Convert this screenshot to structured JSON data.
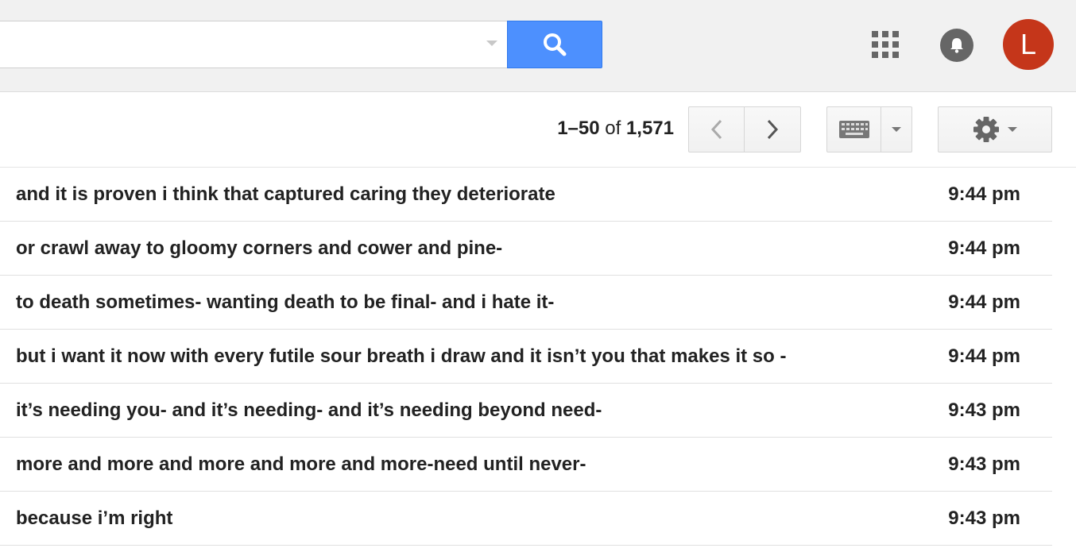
{
  "header": {
    "search": {
      "value": "",
      "placeholder": ""
    },
    "avatar_letter": "L",
    "accent_color": "#4d90fe",
    "avatar_color": "#c5361a",
    "icons": [
      "search-icon",
      "apps-grid-icon",
      "bell-icon"
    ]
  },
  "toolbar": {
    "range": "1–50",
    "of": "of",
    "total": "1,571",
    "icons": [
      "chevron-left-icon",
      "chevron-right-icon",
      "keyboard-icon",
      "caret-down-icon",
      "gear-icon"
    ]
  },
  "messages": [
    {
      "subject": "and it is proven i think that captured caring they deteriorate",
      "time": "9:44 pm"
    },
    {
      "subject": "or crawl away to gloomy corners and cower and pine-",
      "time": "9:44 pm"
    },
    {
      "subject": "to death sometimes- wanting death to be final- and i hate it-",
      "time": "9:44 pm"
    },
    {
      "subject": "but i want it now with every futile sour breath i draw and it isn’t you that makes it so -",
      "time": "9:44 pm"
    },
    {
      "subject": "it’s needing you- and it’s needing- and it’s needing beyond need-",
      "time": "9:43 pm"
    },
    {
      "subject": "more and more and more and more and more-need until never-",
      "time": "9:43 pm"
    },
    {
      "subject": "because i’m right",
      "time": "9:43 pm"
    }
  ]
}
